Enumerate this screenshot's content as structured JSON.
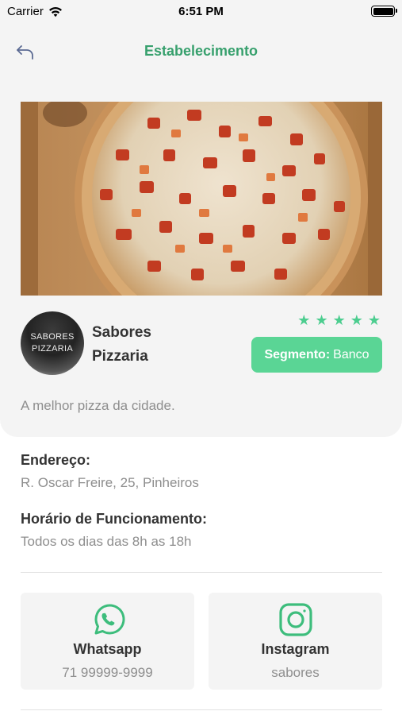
{
  "status_bar": {
    "carrier": "Carrier",
    "time": "6:51 PM",
    "wifi_icon": "wifi-icon",
    "battery_icon": "battery-icon"
  },
  "header": {
    "title": "Estabelecimento",
    "back_icon": "back-arrow-icon"
  },
  "store": {
    "hero_image": "pizza-photo",
    "logo_line1": "SABORES",
    "logo_line2": "PIZZARIA",
    "name_line1": "Sabores",
    "name_line2": "Pizzaria",
    "rating": 5,
    "rating_max": 5,
    "segment_label": "Segmento:",
    "segment_value": "Banco",
    "description": "A melhor pizza da cidade."
  },
  "details": {
    "address_label": "Endereço:",
    "address_value": "R. Oscar Freire, 25, Pinheiros",
    "hours_label": "Horário de Funcionamento:",
    "hours_value": "Todos os dias das 8h as 18h"
  },
  "contacts": [
    {
      "icon": "whatsapp-icon",
      "label": "Whatsapp",
      "value": "71 99999-9999"
    },
    {
      "icon": "instagram-icon",
      "label": "Instagram",
      "value": "sabores"
    }
  ],
  "colors": {
    "accent": "#37a06d",
    "icon_green": "#3dbd7c",
    "segment_bg": "#5ad595",
    "star": "#4ccd8f",
    "card_bg": "#f4f4f4",
    "muted_text": "#8e8e8e"
  }
}
